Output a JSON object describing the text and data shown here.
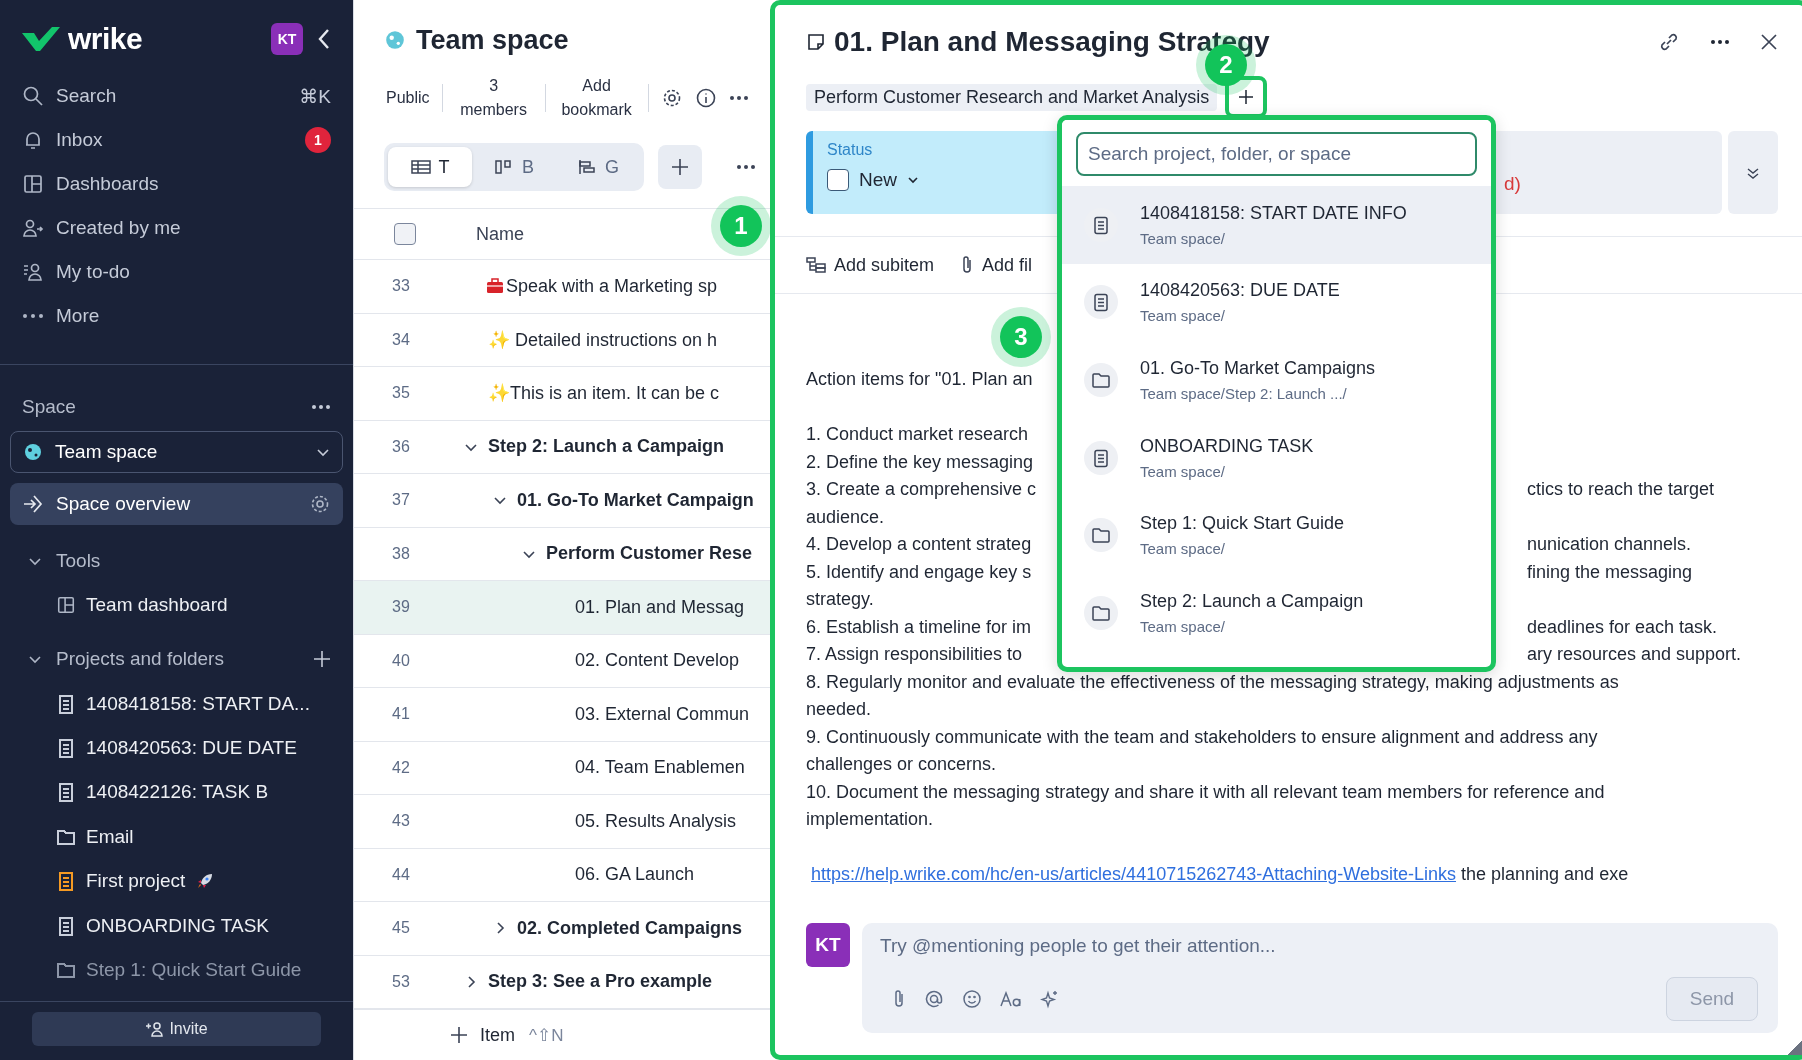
{
  "sidebar": {
    "logo": "wrike",
    "avatar": "KT",
    "nav": [
      {
        "label": "Search",
        "kind": "search",
        "shortcut": "⌘K"
      },
      {
        "label": "Inbox",
        "kind": "bell",
        "badge": "1"
      },
      {
        "label": "Dashboards",
        "kind": "dashboard"
      },
      {
        "label": "Created by me",
        "kind": "person"
      },
      {
        "label": "My to-do",
        "kind": "todo"
      },
      {
        "label": "More",
        "kind": "dots"
      }
    ],
    "space_heading": "Space",
    "space_select": "Team space",
    "space_overview": {
      "label": "Space overview",
      "selected": true
    },
    "tools": {
      "label": "Tools",
      "expanded": true,
      "items": [
        {
          "label": "Team dashboard"
        }
      ]
    },
    "projects": {
      "label": "Projects and folders",
      "expanded": true,
      "items": [
        {
          "label": "1408418158: START DA...",
          "kind": "task",
          "color": "#c9cfdb",
          "rocket": false
        },
        {
          "label": "1408420563: DUE DATE",
          "kind": "task",
          "color": "#c9cfdb",
          "rocket": false
        },
        {
          "label": "1408422126: TASK B",
          "kind": "task",
          "color": "#c9cfdb",
          "rocket": false
        },
        {
          "label": "Email",
          "kind": "folder",
          "color": "#c9cfdb",
          "rocket": false
        },
        {
          "label": "First project",
          "kind": "task",
          "color": "#f59a23",
          "rocket": true
        },
        {
          "label": "ONBOARDING TASK",
          "kind": "task",
          "color": "#c9cfdb",
          "rocket": false
        },
        {
          "label": "Step 1: Quick Start Guide",
          "kind": "folder",
          "color": "#8d96a8",
          "rocket": false
        }
      ]
    },
    "invite": "Invite"
  },
  "space": {
    "title": "Team space",
    "meta": [
      "Public",
      "3 members",
      "Add bookmark"
    ],
    "views": [
      {
        "label": "T",
        "kind": "table",
        "selected": true
      },
      {
        "label": "B",
        "kind": "board",
        "selected": false
      },
      {
        "label": "G",
        "kind": "gantt",
        "selected": false
      }
    ]
  },
  "table": {
    "column": "Name",
    "select_all_checked": false,
    "add_item": "Item",
    "add_shortcut": "^⇧N",
    "rows": [
      {
        "number": "33",
        "name": "Speak with a Marketing sp",
        "toolbox": true,
        "selected": false
      },
      {
        "number": "34",
        "name": "✨ Detailed instructions on h",
        "selected": false
      },
      {
        "number": "35",
        "name": "✨This is an item. It can be c",
        "selected": false
      },
      {
        "number": "36",
        "name": "Step 2: Launch a Campaign",
        "expanded": true,
        "selected": false,
        "children": [
          {
            "number": "37",
            "name": "01. Go-To Market Campaign",
            "expanded": true,
            "selected": false,
            "children": [
              {
                "number": "38",
                "name": "Perform Customer Rese",
                "expanded": true,
                "selected": false,
                "children": [
                  {
                    "number": "39",
                    "name": "01. Plan and Messag",
                    "selected": true
                  },
                  {
                    "number": "40",
                    "name": "02. Content Develop",
                    "selected": false
                  },
                  {
                    "number": "41",
                    "name": "03. External Commun",
                    "selected": false
                  },
                  {
                    "number": "42",
                    "name": "04. Team Enablemen",
                    "selected": false
                  },
                  {
                    "number": "43",
                    "name": "05. Results Analysis",
                    "selected": false
                  },
                  {
                    "number": "44",
                    "name": "06. GA Launch",
                    "selected": false
                  }
                ]
              }
            ]
          },
          {
            "number": "45",
            "name": "02. Completed Campaigns",
            "expanded": false,
            "selected": false
          }
        ]
      },
      {
        "number": "53",
        "name": "Step 3: See a Pro example",
        "expanded": false,
        "selected": false
      }
    ]
  },
  "panel": {
    "title": "01. Plan and Messaging Strategy",
    "parent_tag": "Perform Customer Research and Market Analysis",
    "status": {
      "label": "Status",
      "value": "New",
      "checked": false
    },
    "status_tail": "d)",
    "actions": [
      {
        "label": "Add subitem",
        "kind": "subitem"
      },
      {
        "label": "Add fil",
        "kind": "file"
      }
    ],
    "description": [
      {
        "left": "Action items for \"01. Plan an"
      },
      {
        "left": "1. Conduct market research",
        "gap_before": true
      },
      {
        "left": "2. Define the key messaging"
      },
      {
        "left": "3. Create a comprehensive c",
        "right": "ctics to reach the target"
      },
      {
        "left": "audience."
      },
      {
        "left": "4. Develop a content strateg",
        "right": "nunication channels."
      },
      {
        "left": "5. Identify and engage key s",
        "right": "fining the messaging"
      },
      {
        "left": "strategy."
      },
      {
        "left": "6. Establish a timeline for im",
        "right": "deadlines for each task."
      },
      {
        "left": "7. Assign responsibilities to",
        "right": "ary resources and support."
      },
      {
        "left": "8. Regularly monitor and evaluate the effectiveness of the messaging strategy, making adjustments as"
      },
      {
        "left": "needed."
      },
      {
        "left": "9. Continuously communicate with the team and stakeholders to ensure alignment and address any"
      },
      {
        "left": "challenges or concerns."
      },
      {
        "left": "10. Document the messaging strategy and share it with all relevant team members for reference and"
      },
      {
        "left": "implementation."
      }
    ],
    "link": {
      "url": "https://help.wrike.com/hc/en-us/articles/4410715262743-Attaching-Website-Links",
      "after": "the planning and exe"
    },
    "comment": {
      "avatar": "KT",
      "placeholder": "Try @mentioning people to get their attention...",
      "send": "Send",
      "send_disabled": true
    }
  },
  "dropdown": {
    "placeholder": "Search project, folder, or space",
    "items": [
      {
        "name": "1408418158: START DATE INFO",
        "path": "Team space/",
        "kind": "task",
        "selected": true
      },
      {
        "name": "1408420563: DUE DATE",
        "path": "Team space/",
        "kind": "task",
        "selected": false
      },
      {
        "name": "01. Go-To Market Campaigns",
        "path": "Team space/Step 2: Launch .../",
        "kind": "folder",
        "selected": false
      },
      {
        "name": "ONBOARDING TASK",
        "path": "Team space/",
        "kind": "task",
        "selected": false
      },
      {
        "name": "Step 1: Quick Start Guide",
        "path": "Team space/",
        "kind": "folder",
        "selected": false
      },
      {
        "name": "Step 2: Launch a Campaign",
        "path": "Team space/",
        "kind": "folder",
        "selected": false
      }
    ]
  },
  "annotations": [
    {
      "label": "1"
    },
    {
      "label": "2"
    },
    {
      "label": "3"
    }
  ]
}
